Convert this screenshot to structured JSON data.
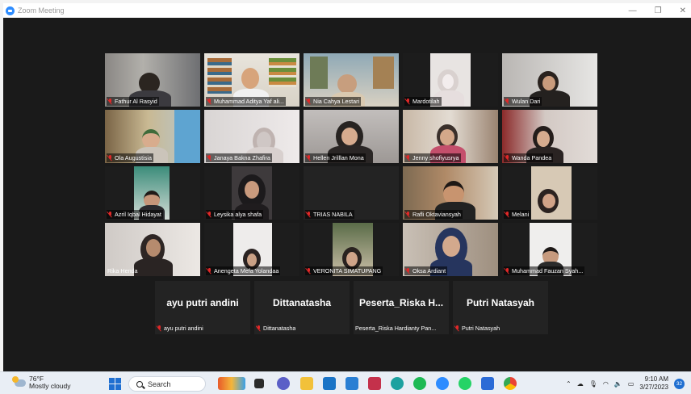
{
  "window": {
    "title": "Zoom Meeting",
    "minimize": "—",
    "maximize": "❐",
    "close": "✕"
  },
  "participants": [
    {
      "name": "Fathur Al Rasyid"
    },
    {
      "name": "Muhammad Aditya Yaf ali..."
    },
    {
      "name": "Nia Cahya Lestari"
    },
    {
      "name": "Mardotilah"
    },
    {
      "name": "Wulan Dari"
    },
    {
      "name": "Ola Augustisia"
    },
    {
      "name": "Janaya Bakna Zhafira"
    },
    {
      "name": "Hellen Jrilllan Mona"
    },
    {
      "name": "Jenny shofiyusrya"
    },
    {
      "name": "Wanda Pandea"
    },
    {
      "name": "Azril Iqbal Hidayat"
    },
    {
      "name": "Leysika alya shafa"
    },
    {
      "name": "TRIAS NABILA"
    },
    {
      "name": "Rafli Oktaviansyah"
    },
    {
      "name": "Melani"
    },
    {
      "name": "Rika Henda"
    },
    {
      "name": "Anengeta Mefa Yolandaa"
    },
    {
      "name": "VERONITA SIMATUPANG"
    },
    {
      "name": "Oksa Ardiant"
    },
    {
      "name": "Muhammad Fauzan Syah..."
    }
  ],
  "video_off": [
    {
      "display": "ayu putri andini",
      "name": "ayu putri andini"
    },
    {
      "display": "Dittanatasha",
      "name": "Dittanatasha"
    },
    {
      "display": "Peserta_Riska  H...",
      "name": "Peserta_Riska Hardianty Pan..."
    },
    {
      "display": "Putri Natasyah",
      "name": "Putri Natasyah"
    }
  ],
  "taskbar": {
    "weather_temp": "76°F",
    "weather_desc": "Mostly cloudy",
    "search_placeholder": "Search",
    "time": "9:10 AM",
    "date": "3/27/2023",
    "notification_count": "32"
  }
}
